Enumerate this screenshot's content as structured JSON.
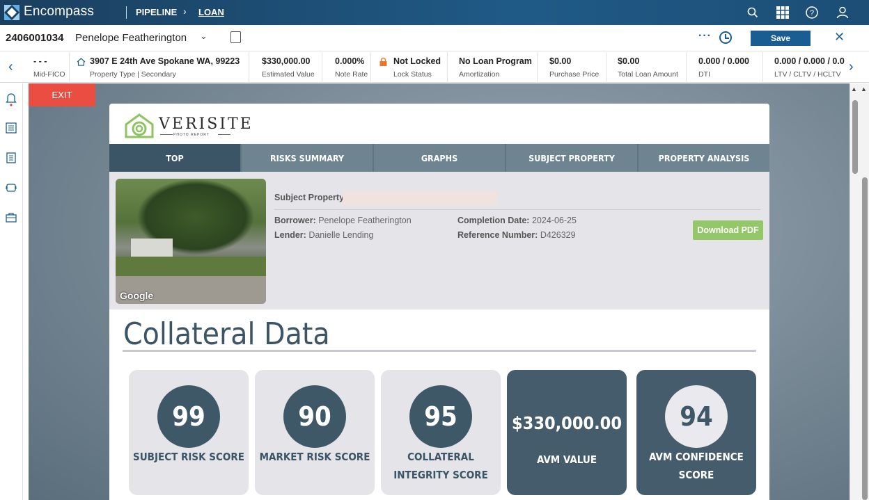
{
  "app": {
    "brand": "Encompass",
    "breadcrumb": [
      "PIPELINE",
      "LOAN"
    ],
    "colors": {
      "nav": "#1f5a86",
      "accent": "#1a5d92",
      "exit": "#ea4e42",
      "download": "#93c768",
      "score_dark": "#445c6b"
    }
  },
  "loan": {
    "number": "2406001034",
    "borrower": "Penelope Featherington",
    "save_label": "Save",
    "more_icon": "ellipsis-icon",
    "history_icon": "clock-icon",
    "close_icon": "close-icon"
  },
  "info_strip": [
    {
      "value": "- - -",
      "label": "Mid-FICO"
    },
    {
      "value": "3907 E 24th Ave Spokane WA, 99223",
      "label": "Property Type | Secondary"
    },
    {
      "value": "$330,000.00",
      "label": "Estimated Value"
    },
    {
      "value": "0.000%",
      "label": "Note Rate"
    },
    {
      "value": "Not Locked",
      "label": "Lock Status"
    },
    {
      "value": "No Loan Program",
      "label": "Amortization"
    },
    {
      "value": "$0.00",
      "label": "Purchase Price"
    },
    {
      "value": "$0.00",
      "label": "Total Loan Amount"
    },
    {
      "value": "0.000 / 0.000",
      "label": "DTI"
    },
    {
      "value": "0.000 / 0.000 / 0.0",
      "label": "LTV / CLTV / HCLTV"
    }
  ],
  "main": {
    "exit_label": "EXIT"
  },
  "report": {
    "brand": "VERISITE",
    "brand_sub": "PHOTO REPORT",
    "tabs": [
      "TOP",
      "RISKS SUMMARY",
      "GRAPHS",
      "SUBJECT PROPERTY",
      "PROPERTY ANALYSIS"
    ],
    "active_tab": "TOP",
    "photo_credit": "Google",
    "subject_property_label": "Subject Property:",
    "borrower_label": "Borrower:",
    "borrower_value": "Penelope Featherington",
    "lender_label": "Lender:",
    "lender_value": "Danielle Lending",
    "completion_label": "Completion Date:",
    "completion_value": "2024-06-25",
    "reference_label": "Reference Number:",
    "reference_value": "D426329",
    "download_label": "Download PDF",
    "section_title": "Collateral Data",
    "scores": [
      {
        "value": "99",
        "label_lines": [
          "SUBJECT RISK SCORE"
        ]
      },
      {
        "value": "90",
        "label_lines": [
          "MARKET RISK SCORE"
        ]
      },
      {
        "value": "95",
        "label_lines": [
          "COLLATERAL",
          "INTEGRITY SCORE"
        ]
      },
      {
        "value": "$330,000.00",
        "label_lines": [
          "AVM VALUE"
        ]
      },
      {
        "value": "94",
        "label_lines": [
          "AVM CONFIDENCE",
          "SCORE"
        ]
      }
    ]
  }
}
